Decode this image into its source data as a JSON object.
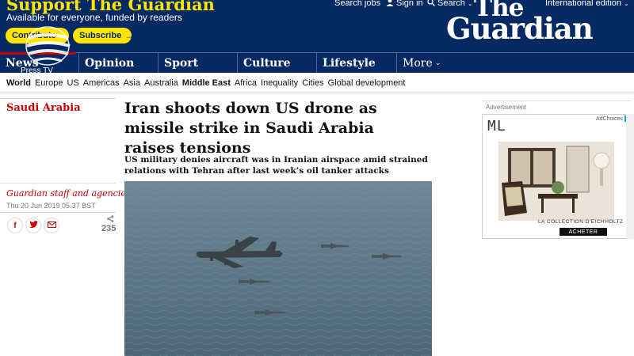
{
  "support": {
    "title": "Support The Guardian",
    "subtitle": "Available for everyone, funded by readers",
    "contribute_label": "Contribute",
    "subscribe_label": "Subscribe",
    "arrow": "→"
  },
  "top_links": {
    "jobs": "Search jobs",
    "signin": "Sign in",
    "search": "Search",
    "edition": "International edition"
  },
  "logo": {
    "line1": "The",
    "line2": "Guardian"
  },
  "pillars": [
    {
      "label": "News"
    },
    {
      "label": "Opinion"
    },
    {
      "label": "Sport"
    },
    {
      "label": "Culture"
    },
    {
      "label": "Lifestyle"
    },
    {
      "label": "More"
    }
  ],
  "pillar_sub": "Press TV",
  "subnav": [
    "World",
    "Europe",
    "US",
    "Americas",
    "Asia",
    "Australia",
    "Middle East",
    "Africa",
    "Inequality",
    "Cities",
    "Global development"
  ],
  "article": {
    "section": "Saudi Arabia",
    "headline": "Iran shoots down US drone as missile strike in Saudi Arabia raises tensions",
    "standfirst": "US military denies aircraft was in Iranian airspace amid strained relations with Tehran after last week’s oil tanker attacks",
    "byline": "Guardian staff and agencies",
    "date": "Thu 20 Jun 2019 05.37 BST",
    "share_count": "235"
  },
  "ad": {
    "label": "Advertisement",
    "brand": "ML",
    "choices": "AdChoices",
    "collection": "LA COLLECTION D'EICHHOLTZ",
    "cta": "ACHETER"
  },
  "colors": {
    "brand_blue": "#052962",
    "support_yellow": "#ffe500",
    "news_red": "#c70000"
  }
}
